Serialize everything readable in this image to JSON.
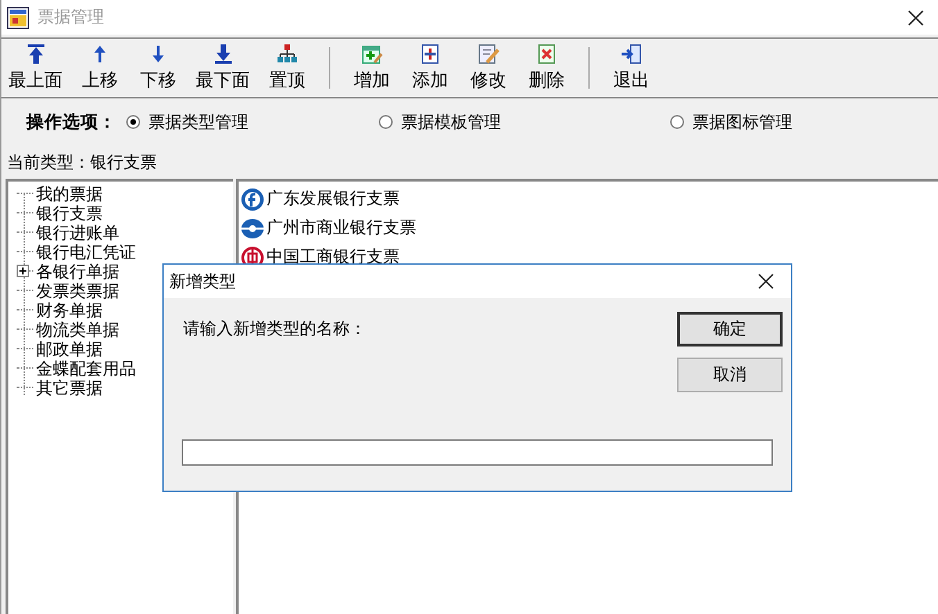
{
  "window": {
    "title": "票据管理"
  },
  "toolbar_groups": [
    [
      {
        "label": "最上面"
      },
      {
        "label": "上移"
      },
      {
        "label": "下移"
      },
      {
        "label": "最下面"
      },
      {
        "label": "置顶"
      }
    ],
    [
      {
        "label": "增加"
      },
      {
        "label": "添加"
      },
      {
        "label": "修改"
      },
      {
        "label": "删除"
      }
    ],
    [
      {
        "label": "退出"
      }
    ]
  ],
  "options": {
    "label": "操作选项：",
    "radios": [
      {
        "label": "票据类型管理",
        "selected": true
      },
      {
        "label": "票据模板管理",
        "selected": false
      },
      {
        "label": "票据图标管理",
        "selected": false
      }
    ]
  },
  "current_type": {
    "label": "当前类型：",
    "value": "银行支票"
  },
  "tree": {
    "items": [
      {
        "label": "我的票据",
        "kind": "leaf"
      },
      {
        "label": "银行支票",
        "kind": "leaf"
      },
      {
        "label": "银行进账单",
        "kind": "leaf"
      },
      {
        "label": "银行电汇凭证",
        "kind": "leaf"
      },
      {
        "label": "各银行单据",
        "kind": "folder",
        "expanded": false
      },
      {
        "label": "发票类票据",
        "kind": "leaf"
      },
      {
        "label": "财务单据",
        "kind": "leaf"
      },
      {
        "label": "物流类单据",
        "kind": "leaf"
      },
      {
        "label": "邮政单据",
        "kind": "leaf"
      },
      {
        "label": "金蝶配套用品",
        "kind": "leaf"
      },
      {
        "label": "其它票据",
        "kind": "leaf"
      }
    ]
  },
  "list": {
    "items": [
      {
        "label": "广东发展银行支票"
      },
      {
        "label": "广州市商业银行支票"
      },
      {
        "label": "中国工商银行支票"
      }
    ]
  },
  "dialog": {
    "title": "新增类型",
    "prompt": "请输入新增类型的名称：",
    "buttons": [
      {
        "label": "确定",
        "kind": "default"
      },
      {
        "label": "取消",
        "kind": "normal"
      }
    ]
  }
}
